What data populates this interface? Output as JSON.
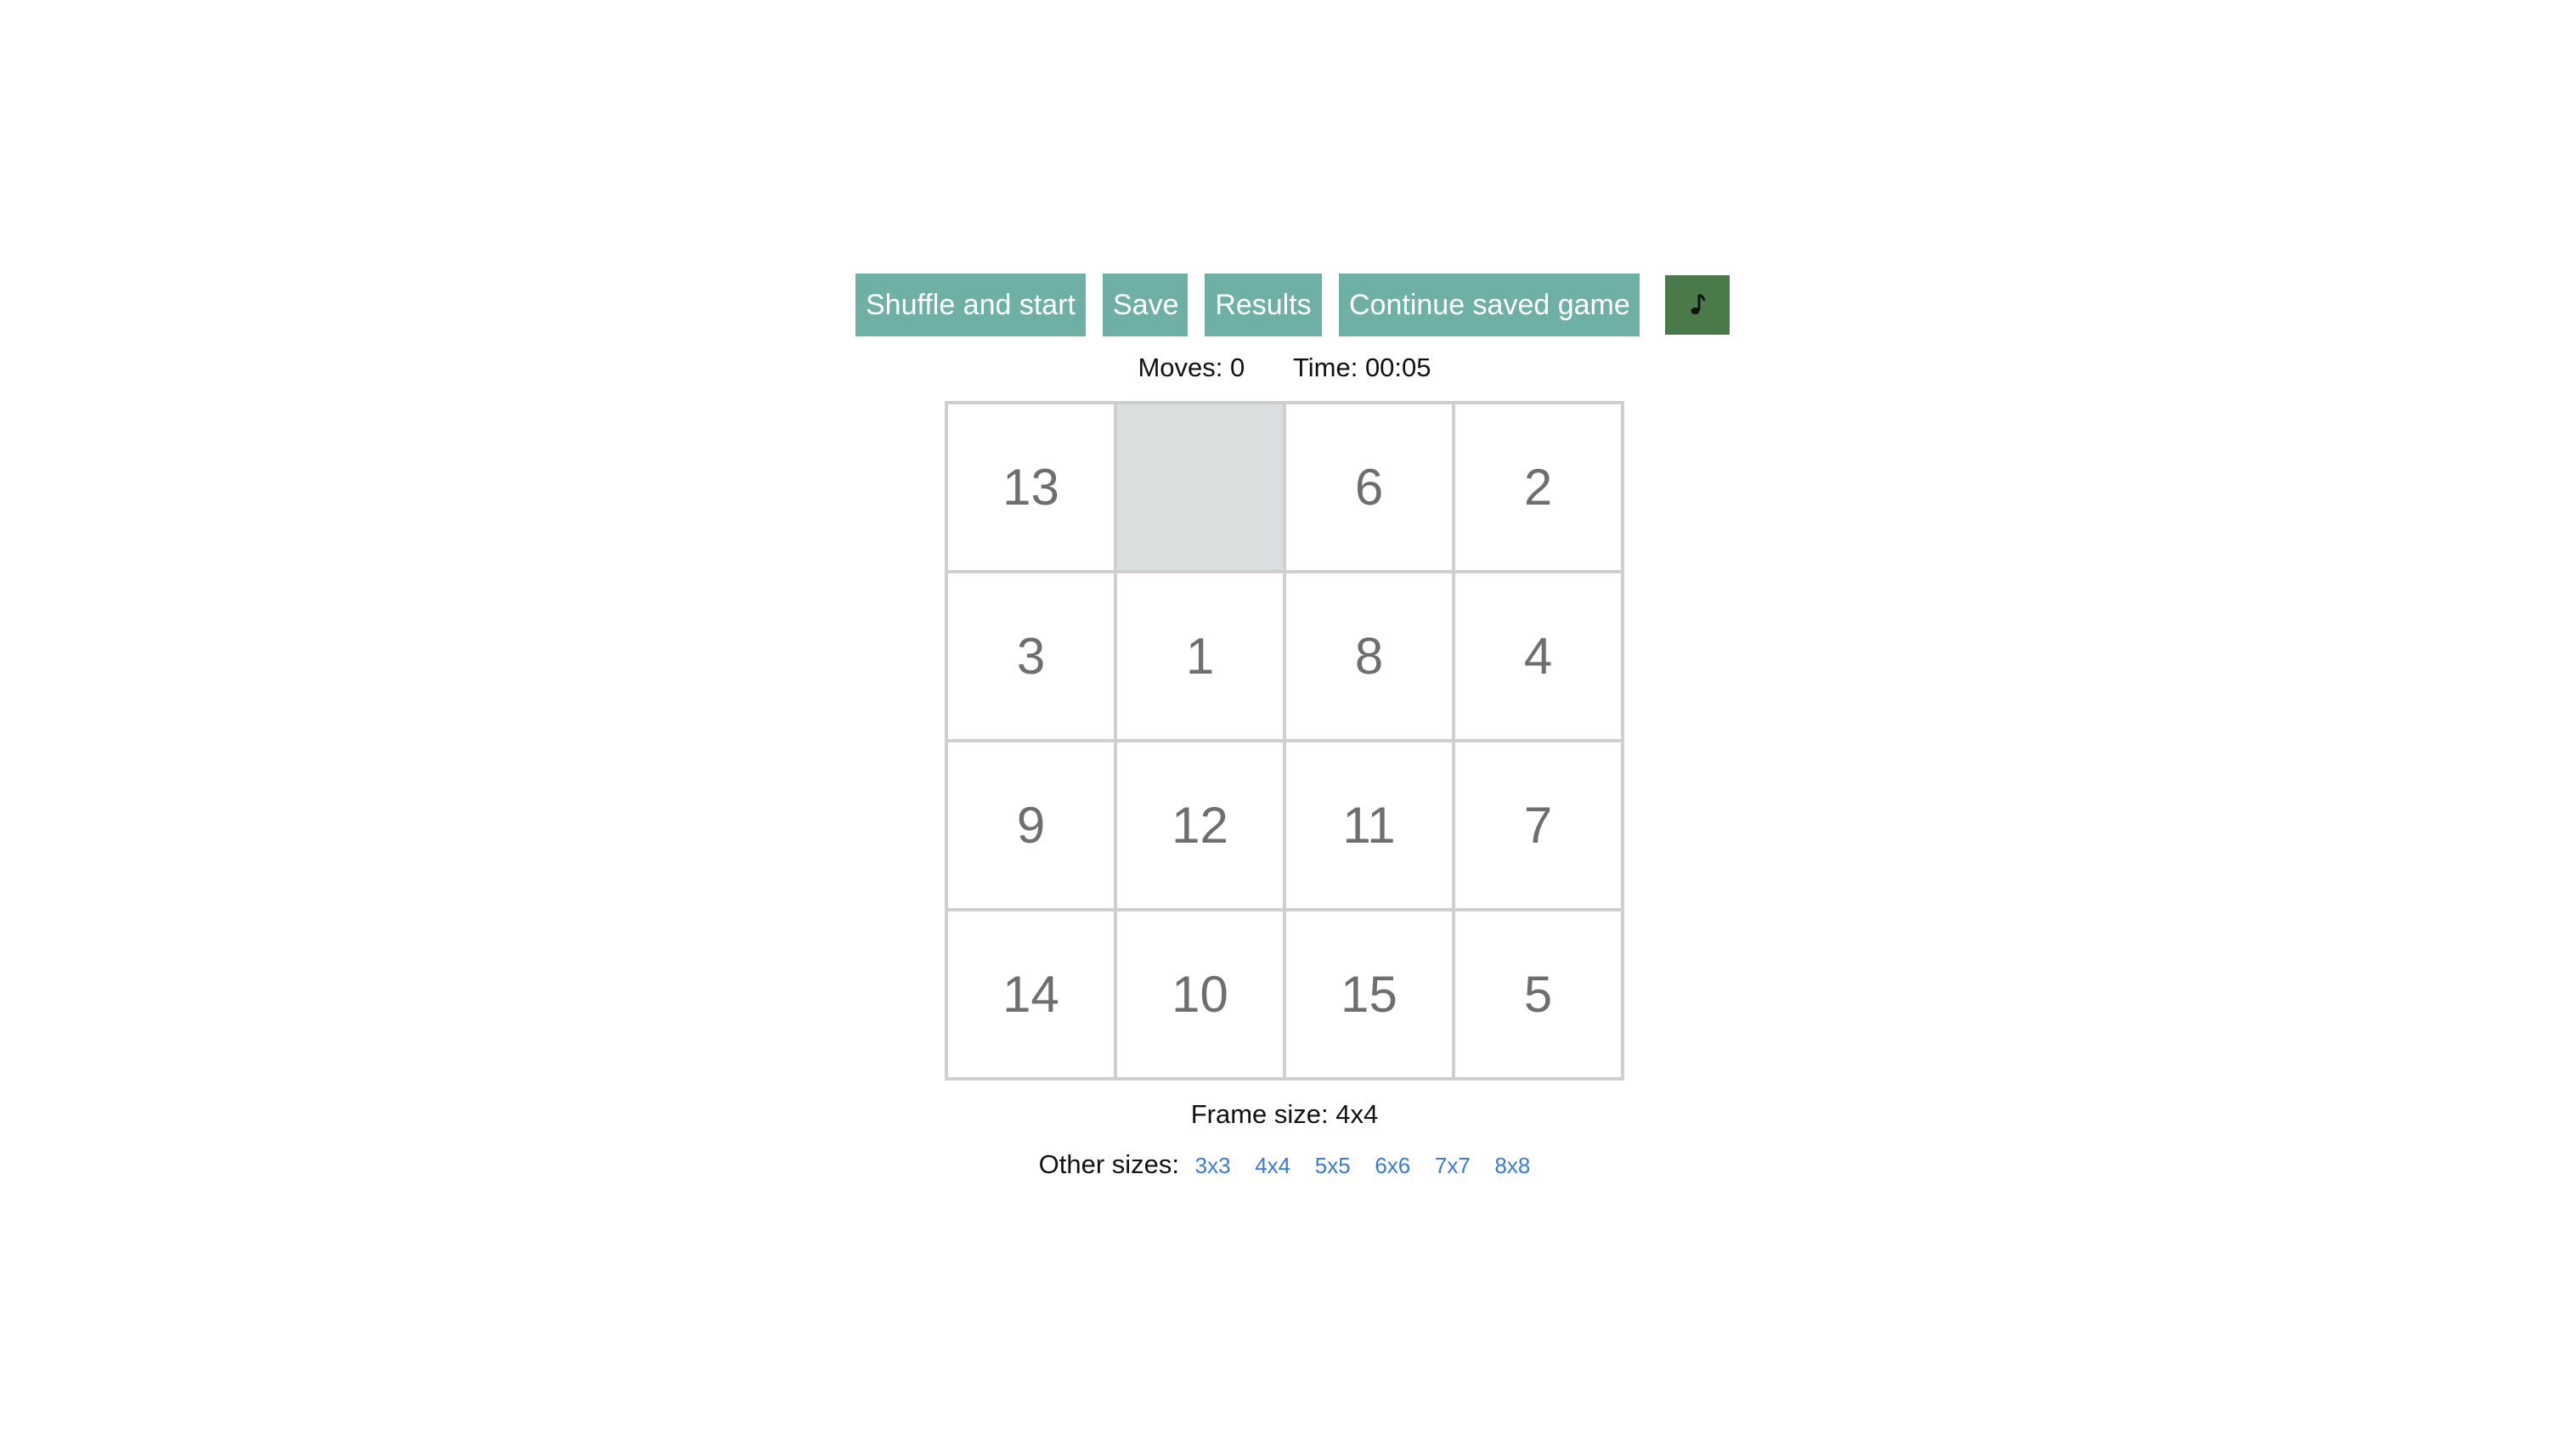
{
  "toolbar": {
    "shuffle_label": "Shuffle and start",
    "save_label": "Save",
    "results_label": "Results",
    "continue_label": "Continue saved game",
    "music_icon": "music-note-icon",
    "accent_color": "#6fb0a6",
    "music_button_color": "#4a7a4a"
  },
  "status": {
    "moves_label": "Moves:",
    "moves_value": "0",
    "time_label": "Time:",
    "time_value": "00:05"
  },
  "board": {
    "size": 4,
    "tiles": [
      "13",
      "",
      "6",
      "2",
      "3",
      "1",
      "8",
      "4",
      "9",
      "12",
      "11",
      "7",
      "14",
      "10",
      "15",
      "5"
    ],
    "empty_color": "#d9dfde"
  },
  "frame": {
    "label": "Frame size:",
    "value": "4x4"
  },
  "other_sizes": {
    "label": "Other sizes:",
    "options": [
      "3x3",
      "4x4",
      "5x5",
      "6x6",
      "7x7",
      "8x8"
    ],
    "link_color": "#3a7bd5"
  }
}
